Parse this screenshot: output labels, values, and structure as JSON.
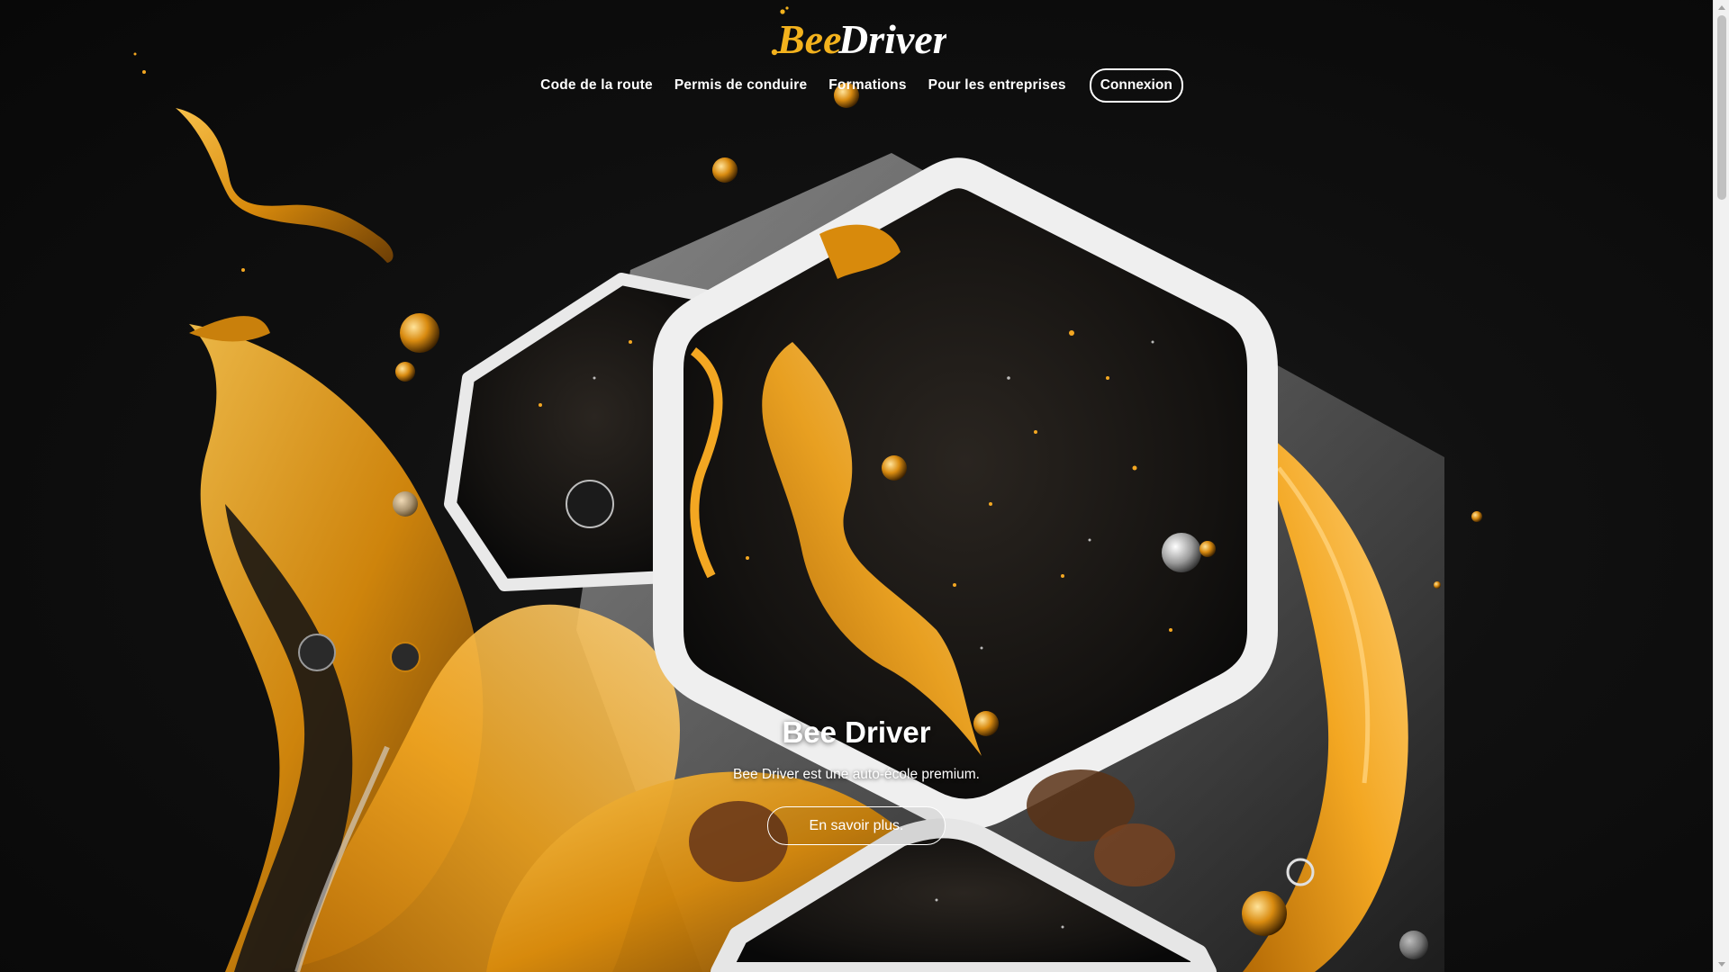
{
  "brand": {
    "logo_part1": "Bee",
    "logo_part2": "Driver"
  },
  "nav": {
    "items": [
      {
        "label": "Code de la route"
      },
      {
        "label": "Permis de conduire"
      },
      {
        "label": "Formations"
      },
      {
        "label": "Pour les entreprises"
      }
    ],
    "login_label": "Connexion"
  },
  "hero": {
    "title": "Bee Driver",
    "subtitle": "Bee Driver est une auto-école premium.",
    "cta_label": "En savoir plus."
  },
  "colors": {
    "background": "#0d0d0d",
    "accent_gold": "#e8a317",
    "text": "#ffffff"
  }
}
